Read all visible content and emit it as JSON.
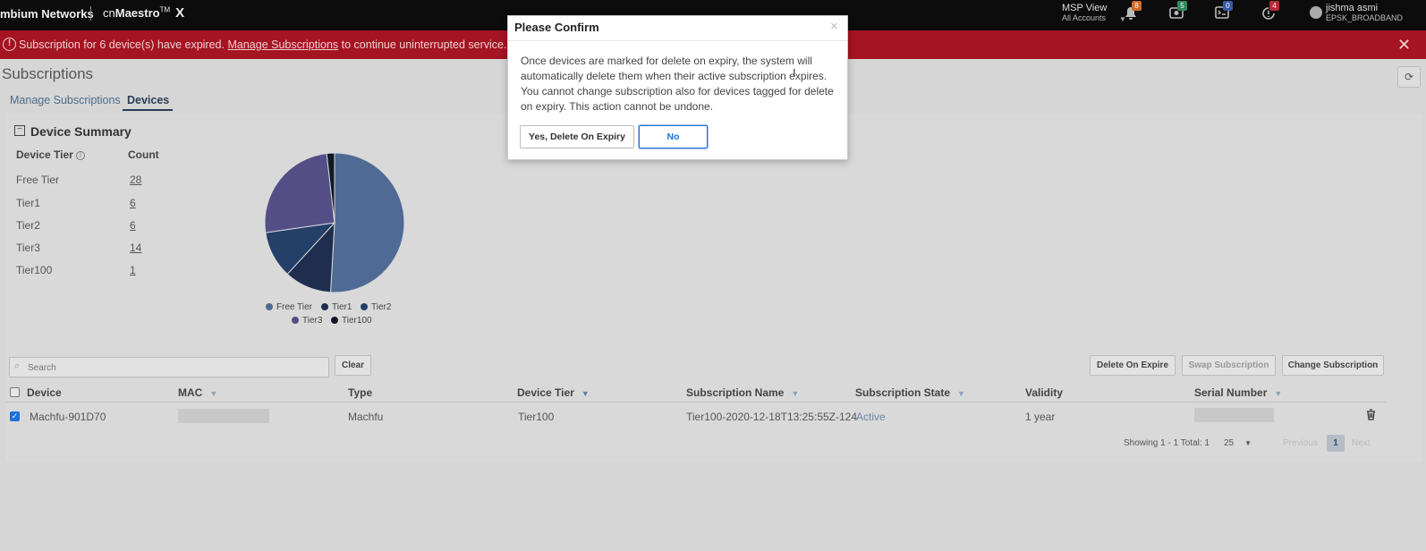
{
  "topbar": {
    "brand": "mbium Networks",
    "product_prefix": "cn",
    "product_name": "Maestro",
    "product_tm": "TM",
    "product_x": "X",
    "msp_view": "MSP View",
    "msp_accounts": "All Accounts",
    "badges": {
      "notifications": "8",
      "devices": "5",
      "terminal": "0",
      "alarms": "4"
    },
    "user_name": "jishma asmi",
    "user_org": "EPSK_BROADBAND"
  },
  "alert": {
    "text_before": "Subscription for 6 device(s) have expired.",
    "link": "Manage Subscriptions",
    "text_after": "to continue uninterrupted service."
  },
  "page": {
    "title": "Subscriptions",
    "tabs": [
      {
        "label": "Manage Subscriptions"
      },
      {
        "label": "Devices"
      }
    ]
  },
  "summary": {
    "title": "Device Summary",
    "col_tier": "Device Tier",
    "col_count": "Count",
    "rows": [
      {
        "tier": "Free Tier",
        "count": "28"
      },
      {
        "tier": "Tier1",
        "count": "6"
      },
      {
        "tier": "Tier2",
        "count": "6"
      },
      {
        "tier": "Tier3",
        "count": "14"
      },
      {
        "tier": "Tier100",
        "count": "1"
      }
    ]
  },
  "chart_data": {
    "type": "pie",
    "categories": [
      "Free Tier",
      "Tier1",
      "Tier2",
      "Tier3",
      "Tier100"
    ],
    "values": [
      28,
      6,
      6,
      14,
      1
    ],
    "colors": [
      "#4f6b95",
      "#1f2d4e",
      "#243f68",
      "#534f86",
      "#111827"
    ],
    "legend_position": "bottom"
  },
  "table": {
    "search_placeholder": "Search",
    "clear_label": "Clear",
    "delete_on_expire_label": "Delete On Expire",
    "swap_label": "Swap Subscription",
    "change_label": "Change Subscription",
    "columns": [
      "Device",
      "MAC",
      "Type",
      "Device Tier",
      "Subscription Name",
      "Subscription State",
      "Validity",
      "Serial Number"
    ],
    "rows": [
      {
        "device": "Machfu-901D70",
        "type": "Machfu",
        "tier": "Tier100",
        "subscription_name": "Tier100-2020-12-18T13:25:55Z-124",
        "state": "Active",
        "validity": "1 year"
      }
    ],
    "pager": {
      "showing": "Showing 1 - 1 Total: 1",
      "page_size": "25",
      "previous": "Previous",
      "page": "1",
      "next": "Next"
    }
  },
  "modal": {
    "title": "Please Confirm",
    "close": "×",
    "body": "Once devices are marked for delete on expiry, the system will automatically delete them when their active subscription expires. You cannot change subscription also for devices tagged for delete on expiry. This action cannot be undone.",
    "yes_label": "Yes, Delete On Expiry",
    "no_label": "No"
  }
}
